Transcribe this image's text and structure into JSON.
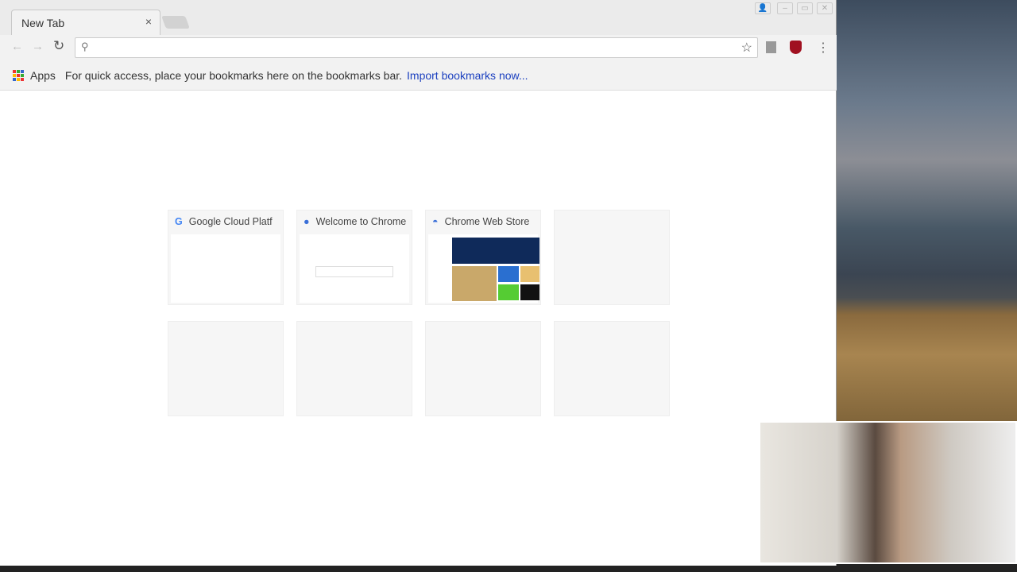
{
  "tab": {
    "title": "New Tab",
    "close": "×"
  },
  "toolbar": {
    "back": "←",
    "forward": "→",
    "reload": "↻",
    "search_icon": "⚲",
    "star": "☆",
    "menu": "⋮",
    "omnibox_value": ""
  },
  "bookmarks": {
    "apps_label": "Apps",
    "hint": "For quick access, place your bookmarks here on the bookmarks bar.",
    "import_link": "Import bookmarks now..."
  },
  "tiles": [
    {
      "title": "Google Cloud Platf",
      "icon": "google-icon",
      "favicon": "G"
    },
    {
      "title": "Welcome to Chrome",
      "icon": "chrome-icon",
      "favicon": "●"
    },
    {
      "title": "Chrome Web Store",
      "icon": "web-store-icon",
      "favicon": "◓"
    }
  ],
  "colors": {
    "link": "#1a3fbf",
    "ublock": "#a01020"
  }
}
